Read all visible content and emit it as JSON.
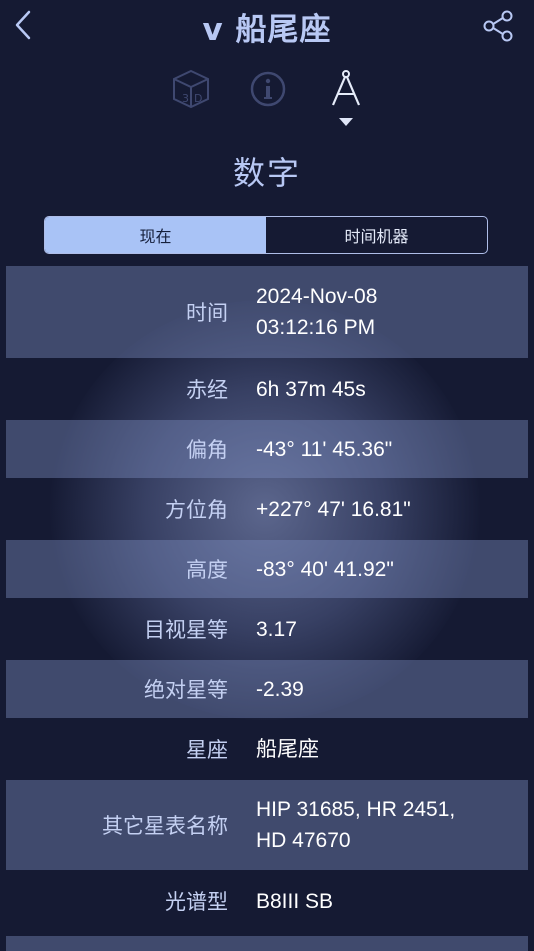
{
  "header": {
    "title": "v 船尾座"
  },
  "modes": [
    {
      "name": "3d-view",
      "icon": "cube-3d-icon"
    },
    {
      "name": "info",
      "icon": "info-icon"
    },
    {
      "name": "numbers",
      "icon": "compass-icon",
      "selected": true
    }
  ],
  "section": {
    "title": "数字"
  },
  "tabs": {
    "now_label": "现在",
    "time_machine_label": "时间机器",
    "active": "now"
  },
  "rows": [
    {
      "label": "时间",
      "value_lines": [
        "2024-Nov-08",
        "03:12:16 PM"
      ]
    },
    {
      "label": "赤经",
      "value_lines": [
        "6h 37m 45s"
      ]
    },
    {
      "label": "偏角",
      "value_lines": [
        "-43° 11' 45.36\""
      ]
    },
    {
      "label": "方位角",
      "value_lines": [
        "+227° 47' 16.81\""
      ]
    },
    {
      "label": "高度",
      "value_lines": [
        "-83° 40' 41.92\""
      ]
    },
    {
      "label": "目视星等",
      "value_lines": [
        "3.17"
      ]
    },
    {
      "label": "绝对星等",
      "value_lines": [
        "-2.39"
      ]
    },
    {
      "label": "星座",
      "value_lines": [
        "船尾座"
      ]
    },
    {
      "label": "其它星表名称",
      "value_lines": [
        "HIP 31685, HR 2451,",
        "HD 47670"
      ]
    },
    {
      "label": "光谱型",
      "value_lines": [
        "B8III SB"
      ]
    }
  ],
  "colors": {
    "background": "#151a33",
    "accent": "#b8c8f4",
    "active_tab": "#a9c3f6"
  }
}
